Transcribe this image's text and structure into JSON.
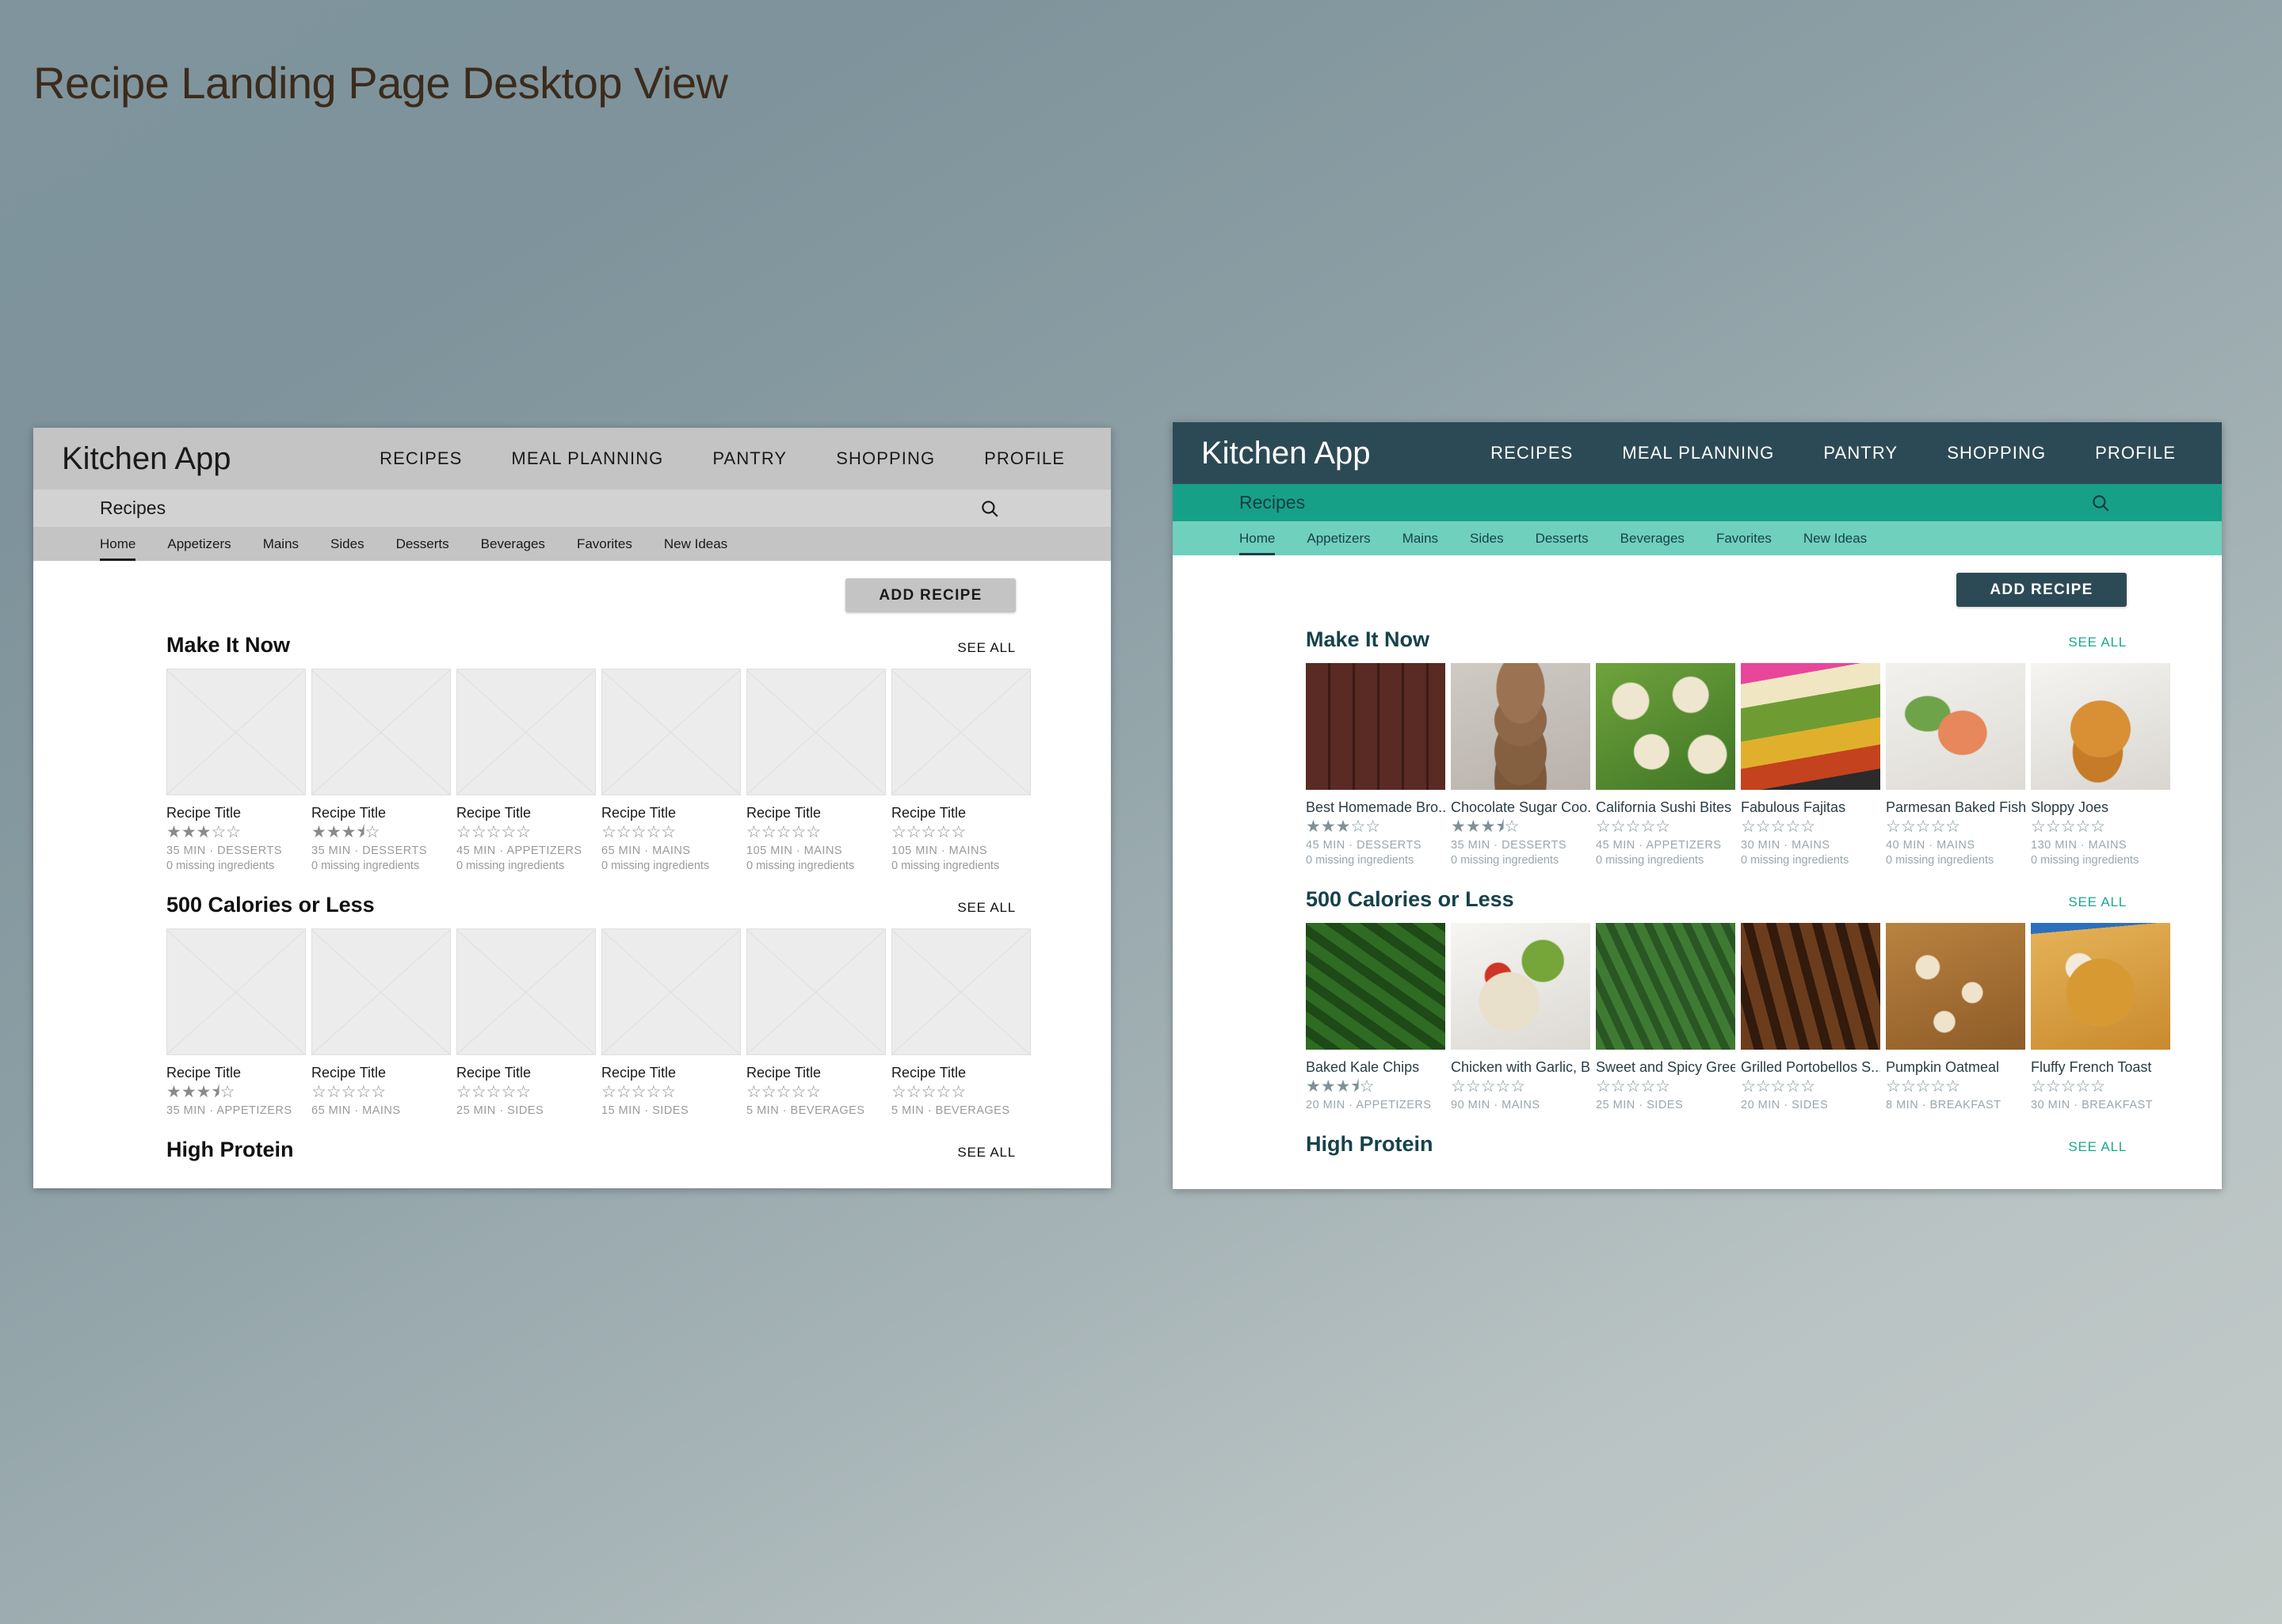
{
  "page": {
    "title": "Recipe Landing Page Desktop View",
    "title_color": "#3b2b1c",
    "background": "#8b9ea4"
  },
  "theme": {
    "left": {
      "appbar_bg": "#c4c4c4",
      "subbar_bg": "#d2d2d2",
      "tabs_bg": "#c4c4c4",
      "accent": "#1a1a1a",
      "button_bg": "#c4c4c4",
      "see_all_color": "#111111"
    },
    "right": {
      "appbar_bg": "#2c4a55",
      "subbar_bg": "#17a088",
      "tabs_bg": "#6fd0bd",
      "accent": "#16424a",
      "button_bg": "#2c4a55",
      "see_all_color": "#1aa78c"
    }
  },
  "app": {
    "brand": "Kitchen App",
    "nav": [
      "RECIPES",
      "MEAL PLANNING",
      "PANTRY",
      "SHOPPING",
      "PROFILE"
    ],
    "subbar_title": "Recipes",
    "search_icon": "search-icon",
    "tabs": [
      "Home",
      "Appetizers",
      "Mains",
      "Sides",
      "Desserts",
      "Beverages",
      "Favorites",
      "New Ideas"
    ],
    "active_tab": "Home",
    "add_button": "ADD RECIPE",
    "see_all": "SEE ALL",
    "missing_text": "0 missing ingredients"
  },
  "sections": {
    "make_it_now": "Make It Now",
    "calories": "500 Calories or Less",
    "high_protein": "High Protein"
  },
  "left_panel": {
    "make_it_now": [
      {
        "title": "Recipe Title",
        "rating": 3,
        "meta": "35 MIN · DESSERTS",
        "missing": "0 missing ingredients"
      },
      {
        "title": "Recipe Title",
        "rating": 3.5,
        "meta": "35 MIN · DESSERTS",
        "missing": "0 missing ingredients"
      },
      {
        "title": "Recipe Title",
        "rating": 0,
        "meta": "45 MIN · APPETIZERS",
        "missing": "0 missing ingredients"
      },
      {
        "title": "Recipe Title",
        "rating": 0,
        "meta": "65 MIN · MAINS",
        "missing": "0 missing ingredients"
      },
      {
        "title": "Recipe Title",
        "rating": 0,
        "meta": "105 MIN · MAINS",
        "missing": "0 missing ingredients"
      },
      {
        "title": "Recipe Title",
        "rating": 0,
        "meta": "105 MIN · MAINS",
        "missing": "0 missing ingredients"
      }
    ],
    "calories": [
      {
        "title": "Recipe Title",
        "rating": 3.5,
        "meta": "35 MIN · APPETIZERS",
        "missing": ""
      },
      {
        "title": "Recipe Title",
        "rating": 0,
        "meta": "65 MIN · MAINS",
        "missing": ""
      },
      {
        "title": "Recipe Title",
        "rating": 0,
        "meta": "25 MIN · SIDES",
        "missing": ""
      },
      {
        "title": "Recipe Title",
        "rating": 0,
        "meta": "15 MIN · SIDES",
        "missing": ""
      },
      {
        "title": "Recipe Title",
        "rating": 0,
        "meta": "5 MIN · BEVERAGES",
        "missing": ""
      },
      {
        "title": "Recipe Title",
        "rating": 0,
        "meta": "5 MIN · BEVERAGES",
        "missing": ""
      }
    ]
  },
  "right_panel": {
    "make_it_now": [
      {
        "title": "Best Homemade Bro...",
        "rating": 3,
        "meta": "45 MIN · DESSERTS",
        "missing": "0 missing ingredients",
        "img": "brownies"
      },
      {
        "title": "Chocolate Sugar Coo...",
        "rating": 3.5,
        "meta": "35 MIN · DESSERTS",
        "missing": "0 missing ingredients",
        "img": "cookies"
      },
      {
        "title": "California Sushi Bites",
        "rating": 0,
        "meta": "45 MIN · APPETIZERS",
        "missing": "0 missing ingredients",
        "img": "sushi-bites"
      },
      {
        "title": "Fabulous Fajitas",
        "rating": 0,
        "meta": "30 MIN · MAINS",
        "missing": "0 missing ingredients",
        "img": "fajitas"
      },
      {
        "title": "Parmesan Baked Fish",
        "rating": 0,
        "meta": "40 MIN · MAINS",
        "missing": "0 missing ingredients",
        "img": "baked-fish"
      },
      {
        "title": "Sloppy Joes",
        "rating": 0,
        "meta": "130 MIN · MAINS",
        "missing": "0 missing ingredients",
        "img": "sloppy-joes"
      }
    ],
    "calories": [
      {
        "title": "Baked Kale Chips",
        "rating": 3.5,
        "meta": "20 MIN · APPETIZERS",
        "missing": "",
        "img": "kale-chips"
      },
      {
        "title": "Chicken with Garlic, B...",
        "rating": 0,
        "meta": "90 MIN · MAINS",
        "missing": "",
        "img": "chicken-garlic"
      },
      {
        "title": "Sweet and Spicy Gree...",
        "rating": 0,
        "meta": "25 MIN · SIDES",
        "missing": "",
        "img": "green-beans"
      },
      {
        "title": "Grilled Portobellos S...",
        "rating": 0,
        "meta": "20 MIN · SIDES",
        "missing": "",
        "img": "portobellos"
      },
      {
        "title": "Pumpkin Oatmeal",
        "rating": 0,
        "meta": "8 MIN · BREAKFAST",
        "missing": "",
        "img": "pumpkin-oatmeal"
      },
      {
        "title": "Fluffy French Toast",
        "rating": 0,
        "meta": "30 MIN · BREAKFAST",
        "missing": "",
        "img": "french-toast"
      }
    ]
  }
}
